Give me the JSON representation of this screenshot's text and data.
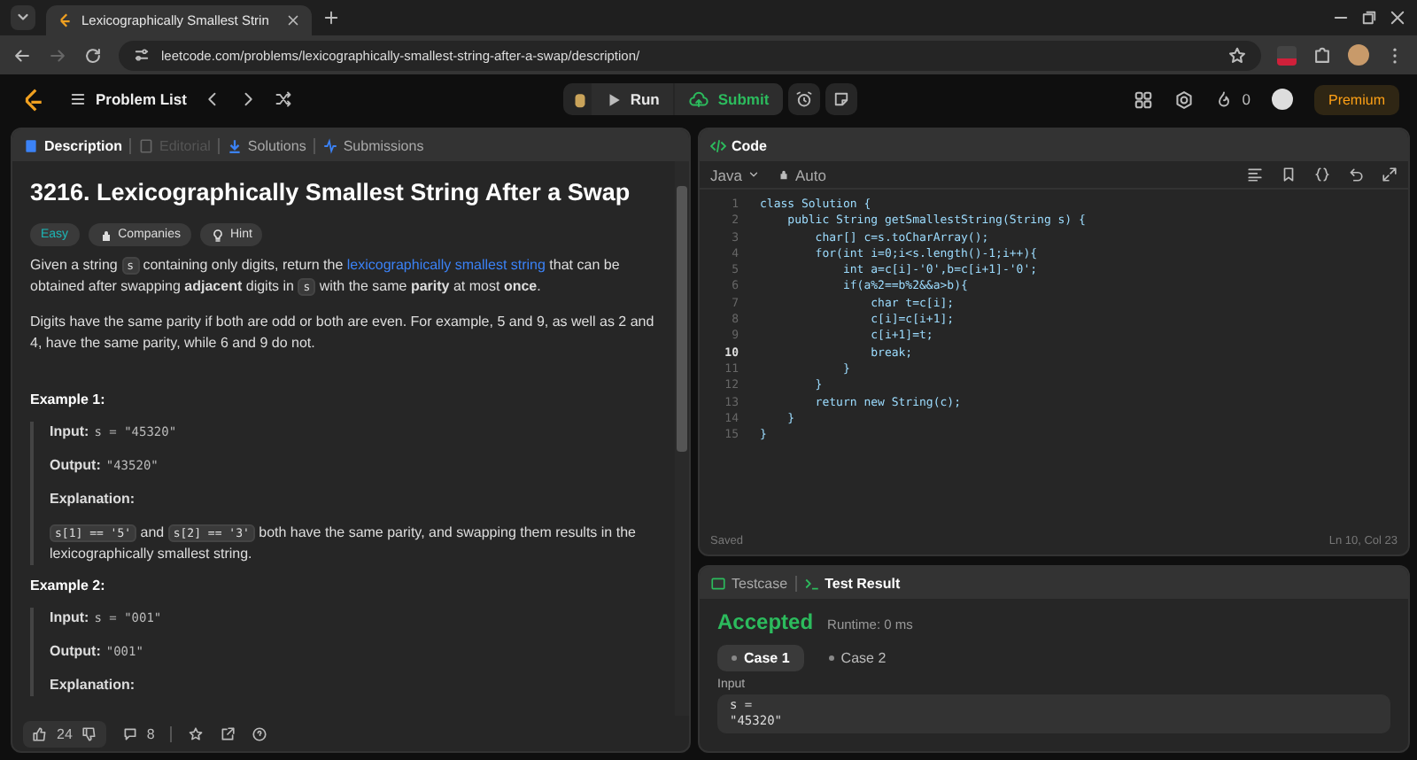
{
  "browser": {
    "tab_title": "Lexicographically Smallest Strin",
    "url": "leetcode.com/problems/lexicographically-smallest-string-after-a-swap/description/"
  },
  "nav": {
    "problem_list": "Problem List",
    "run": "Run",
    "submit": "Submit",
    "streak": "0",
    "premium": "Premium"
  },
  "left_tabs": [
    {
      "label": "Description",
      "selected": true,
      "disabled": false
    },
    {
      "label": "Editorial",
      "selected": false,
      "disabled": true
    },
    {
      "label": "Solutions",
      "selected": false,
      "disabled": false
    },
    {
      "label": "Submissions",
      "selected": false,
      "disabled": false
    }
  ],
  "problem": {
    "title": "3216. Lexicographically Smallest String After a Swap",
    "difficulty": "Easy",
    "tags": [
      "Companies",
      "Hint"
    ],
    "paragraphs": [
      [
        {
          "kind": "text",
          "text": "Given a string "
        },
        {
          "kind": "code",
          "text": "s"
        },
        {
          "kind": "text",
          "text": " containing only digits, return the "
        },
        {
          "kind": "link",
          "text": "lexicographically smallest string"
        },
        {
          "kind": "text",
          "text": " that can be obtained after swapping "
        },
        {
          "kind": "bold",
          "text": "adjacent"
        },
        {
          "kind": "text",
          "text": " digits in "
        },
        {
          "kind": "code",
          "text": "s"
        },
        {
          "kind": "text",
          "text": " with the same "
        },
        {
          "kind": "bold",
          "text": "parity"
        },
        {
          "kind": "text",
          "text": " at most "
        },
        {
          "kind": "bold",
          "text": "once"
        },
        {
          "kind": "text",
          "text": "."
        }
      ],
      [
        {
          "kind": "text",
          "text": "Digits have the same parity if both are odd or both are even. For example, 5 and 9, as well as 2 and 4, have the same parity, while 6 and 9 do not."
        }
      ]
    ],
    "examples": [
      {
        "title": "Example 1:",
        "input_label": "Input:",
        "input": "s = \"45320\"",
        "output_label": "Output:",
        "output": "\"43520\"",
        "explanation_label": "Explanation:",
        "explanation": [
          {
            "kind": "code",
            "text": "s[1] == '5'"
          },
          {
            "kind": "text",
            "text": " and "
          },
          {
            "kind": "code",
            "text": "s[2] == '3'"
          },
          {
            "kind": "text",
            "text": " both have the same parity, and swapping them results in the lexicographically smallest string."
          }
        ]
      },
      {
        "title": "Example 2:",
        "input_label": "Input:",
        "input": "s = \"001\"",
        "output_label": "Output:",
        "output": "\"001\"",
        "explanation_label": "Explanation:"
      }
    ]
  },
  "footer": {
    "likes": "24",
    "comments": "8"
  },
  "editor": {
    "title": "Code",
    "language": "Java",
    "mode": "Auto",
    "status": "Saved",
    "cursor": "Ln 10, Col 23",
    "lines": [
      {
        "number": "1",
        "code": "class Solution {",
        "current": false
      },
      {
        "number": "2",
        "code": "    public String getSmallestString(String s) {",
        "current": false
      },
      {
        "number": "3",
        "code": "        char[] c=s.toCharArray();",
        "current": false
      },
      {
        "number": "4",
        "code": "        for(int i=0;i<s.length()-1;i++){",
        "current": false
      },
      {
        "number": "5",
        "code": "            int a=c[i]-'0',b=c[i+1]-'0';",
        "current": false
      },
      {
        "number": "6",
        "code": "            if(a%2==b%2&&a>b){",
        "current": false
      },
      {
        "number": "7",
        "code": "                char t=c[i];",
        "current": false
      },
      {
        "number": "8",
        "code": "                c[i]=c[i+1];",
        "current": false
      },
      {
        "number": "9",
        "code": "                c[i+1]=t;",
        "current": false
      },
      {
        "number": "10",
        "code": "                break;",
        "current": true
      },
      {
        "number": "11",
        "code": "            }",
        "current": false
      },
      {
        "number": "12",
        "code": "        }",
        "current": false
      },
      {
        "number": "13",
        "code": "        return new String(c);",
        "current": false
      },
      {
        "number": "14",
        "code": "    }",
        "current": false
      },
      {
        "number": "15",
        "code": "}",
        "current": false
      }
    ]
  },
  "tests": {
    "tabs": [
      {
        "label": "Testcase",
        "selected": false
      },
      {
        "label": "Test Result",
        "selected": true
      }
    ],
    "verdict": "Accepted",
    "runtime": "Runtime: 0 ms",
    "cases": [
      {
        "label": "Case 1",
        "selected": true
      },
      {
        "label": "Case 2",
        "selected": false
      }
    ],
    "input_label": "Input",
    "input_name": "s =",
    "input_value": "\"45320\""
  }
}
